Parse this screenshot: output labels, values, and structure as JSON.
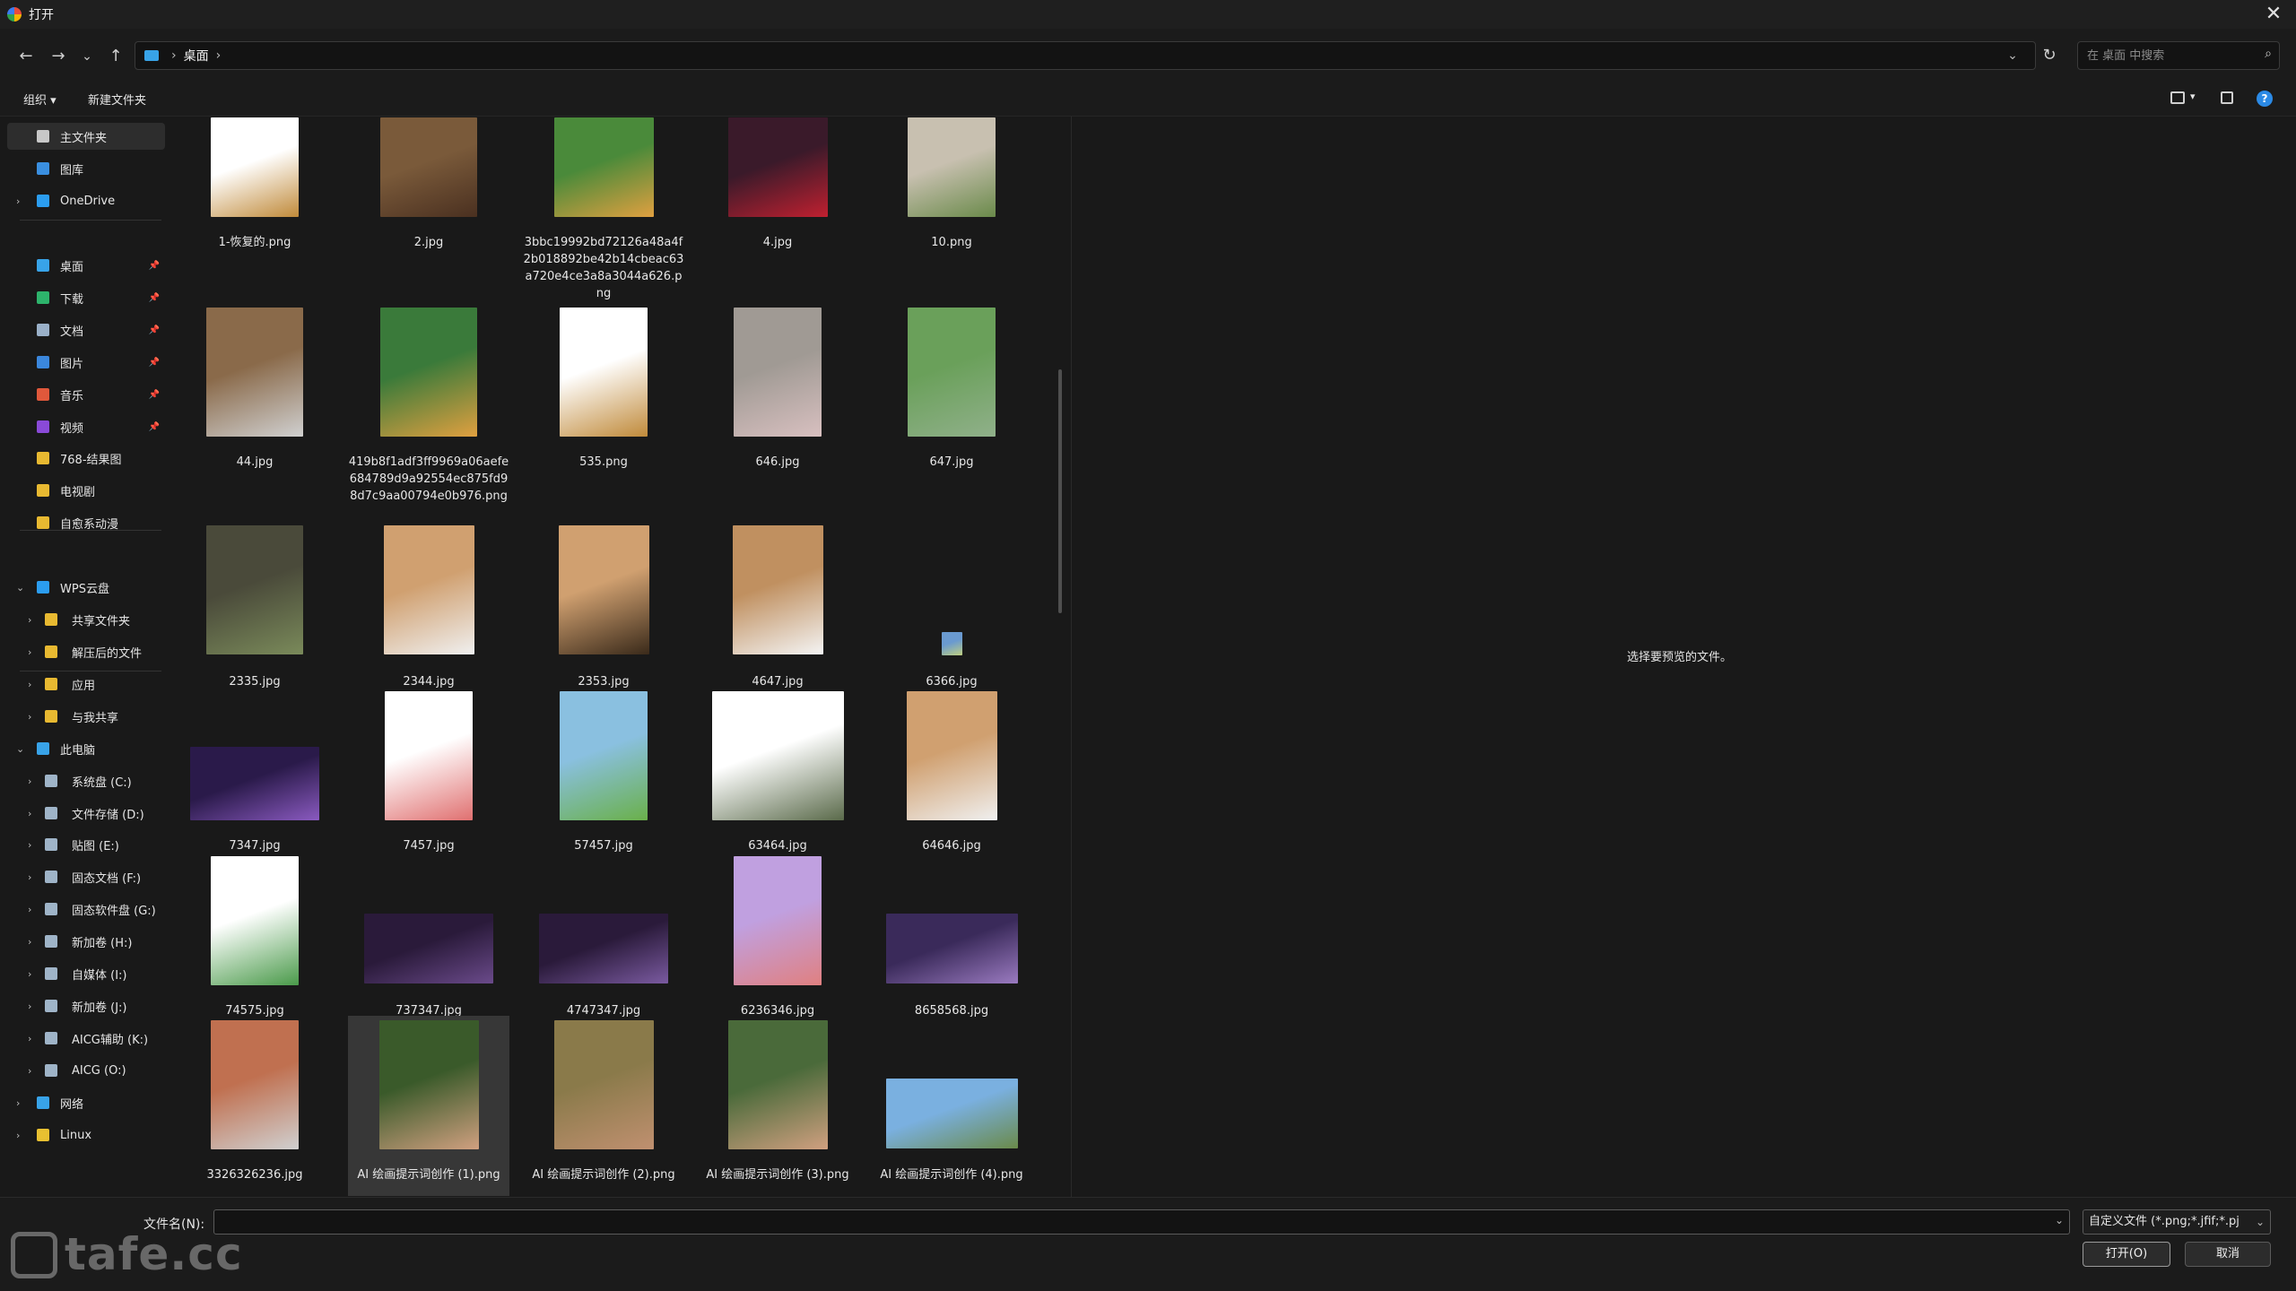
{
  "window": {
    "title": "打开",
    "close": "✕"
  },
  "nav": {
    "back": "←",
    "forward": "→",
    "recent": "⌄",
    "up": "↑",
    "sep": "›",
    "path": "桌面",
    "path_sep_end": "›",
    "addr_dropdown": "⌄",
    "refresh": "↻",
    "search_placeholder": "在 桌面 中搜索",
    "search_icon": "⌕"
  },
  "toolbar": {
    "organize": "组织 ▾",
    "new_folder": "新建文件夹",
    "view_dd": "▾",
    "help": "?"
  },
  "sidebar": {
    "items": [
      {
        "label": "主文件夹",
        "icon": "home-icon",
        "color": "#c8c8c8"
      },
      {
        "label": "图库",
        "icon": "gallery-icon",
        "color": "#3a8fe0"
      },
      {
        "label": "OneDrive",
        "icon": "cloud-icon",
        "color": "#2b9df0"
      },
      {
        "label": "桌面",
        "icon": "desktop-icon",
        "color": "#38a3e8"
      },
      {
        "label": "下载",
        "icon": "download-icon",
        "color": "#2db36b"
      },
      {
        "label": "文档",
        "icon": "document-icon",
        "color": "#9ab0c8"
      },
      {
        "label": "图片",
        "icon": "picture-icon",
        "color": "#3b87dc"
      },
      {
        "label": "音乐",
        "icon": "music-icon",
        "color": "#e0583b"
      },
      {
        "label": "视频",
        "icon": "video-icon",
        "color": "#8a4ad8"
      },
      {
        "label": "768-结果图",
        "icon": "folder-icon",
        "color": "#e8b931"
      },
      {
        "label": "电视剧",
        "icon": "folder-icon",
        "color": "#e8b931"
      },
      {
        "label": "自愈系动漫",
        "icon": "folder-icon",
        "color": "#e8b931"
      },
      {
        "label": "WPS云盘",
        "icon": "cloud-icon",
        "color": "#2b9df0"
      },
      {
        "label": "共享文件夹",
        "icon": "folder-icon",
        "color": "#e8b931"
      },
      {
        "label": "解压后的文件",
        "icon": "folder-icon",
        "color": "#e8b931"
      },
      {
        "label": "应用",
        "icon": "folder-icon",
        "color": "#e8b931"
      },
      {
        "label": "与我共享",
        "icon": "folder-icon",
        "color": "#e8b931"
      },
      {
        "label": "此电脑",
        "icon": "computer-icon",
        "color": "#38a3e8"
      },
      {
        "label": "系统盘 (C:)",
        "icon": "drive-icon",
        "color": "#9fb4c8"
      },
      {
        "label": "文件存储 (D:)",
        "icon": "drive-icon",
        "color": "#9fb4c8"
      },
      {
        "label": "贴图 (E:)",
        "icon": "drive-icon",
        "color": "#9fb4c8"
      },
      {
        "label": "固态文档 (F:)",
        "icon": "drive-icon",
        "color": "#9fb4c8"
      },
      {
        "label": "固态软件盘 (G:)",
        "icon": "drive-icon",
        "color": "#9fb4c8"
      },
      {
        "label": "新加卷 (H:)",
        "icon": "drive-icon",
        "color": "#9fb4c8"
      },
      {
        "label": "自媒体 (I:)",
        "icon": "drive-icon",
        "color": "#9fb4c8"
      },
      {
        "label": "新加卷 (J:)",
        "icon": "drive-icon",
        "color": "#9fb4c8"
      },
      {
        "label": "AICG辅助 (K:)",
        "icon": "drive-icon",
        "color": "#9fb4c8"
      },
      {
        "label": "AICG (O:)",
        "icon": "drive-icon",
        "color": "#9fb4c8"
      },
      {
        "label": "网络",
        "icon": "network-icon",
        "color": "#38a3e8"
      },
      {
        "label": "Linux",
        "icon": "linux-icon",
        "color": "#e8c031"
      }
    ]
  },
  "files": [
    {
      "name": "1-恢复的.png",
      "colors": [
        "#ffffff",
        "#c08a3a"
      ]
    },
    {
      "name": "2.jpg",
      "colors": [
        "#7a5a3a",
        "#4a3020"
      ]
    },
    {
      "name": "3bbc19992bd72126a48a4f2b018892be42b14cbeac63a720e4ce3a8a3044a626.png",
      "colors": [
        "#4a8a3a",
        "#e0a040"
      ]
    },
    {
      "name": "4.jpg",
      "colors": [
        "#3a1a2a",
        "#c02030"
      ]
    },
    {
      "name": "10.png",
      "colors": [
        "#c8c0b0",
        "#6a8a4a"
      ]
    },
    {
      "name": "44.jpg",
      "colors": [
        "#8a6a4a",
        "#d0d0d0"
      ]
    },
    {
      "name": "419b8f1adf3ff9969a06aefe684789d9a92554ec875fd98d7c9aa00794e0b976.png",
      "colors": [
        "#3a7a3a",
        "#e0a040"
      ]
    },
    {
      "name": "535.png",
      "colors": [
        "#ffffff",
        "#c08a3a"
      ]
    },
    {
      "name": "646.jpg",
      "colors": [
        "#a09a94",
        "#d8c0c0"
      ]
    },
    {
      "name": "647.jpg",
      "colors": [
        "#6aa05a",
        "#90b08a"
      ]
    },
    {
      "name": "2335.jpg",
      "colors": [
        "#4a4a3a",
        "#7a8a5a"
      ]
    },
    {
      "name": "2344.jpg",
      "colors": [
        "#d0a070",
        "#f0f0f0"
      ]
    },
    {
      "name": "2353.jpg",
      "colors": [
        "#d0a070",
        "#3a2a1a"
      ]
    },
    {
      "name": "4647.jpg",
      "colors": [
        "#c09060",
        "#f4f4f4"
      ]
    },
    {
      "name": "6366.jpg",
      "colors": [
        "#6a9ad0",
        "#c0d080"
      ]
    },
    {
      "name": "7347.jpg",
      "colors": [
        "#2a1a4a",
        "#8a5ac0"
      ]
    },
    {
      "name": "7457.jpg",
      "colors": [
        "#ffffff",
        "#e07070"
      ]
    },
    {
      "name": "57457.jpg",
      "colors": [
        "#8ac0e0",
        "#6ab04a"
      ]
    },
    {
      "name": "63464.jpg",
      "colors": [
        "#ffffff",
        "#5a6a4a"
      ]
    },
    {
      "name": "64646.jpg",
      "colors": [
        "#d0a070",
        "#f0f0f0"
      ]
    },
    {
      "name": "74575.jpg",
      "colors": [
        "#ffffff",
        "#4a9a4a"
      ]
    },
    {
      "name": "737347.jpg",
      "colors": [
        "#2a1a3a",
        "#6a4a8a"
      ]
    },
    {
      "name": "4747347.jpg",
      "colors": [
        "#2a1a3a",
        "#7a5aa0"
      ]
    },
    {
      "name": "6236346.jpg",
      "colors": [
        "#c0a0e0",
        "#e08080"
      ]
    },
    {
      "name": "8658568.jpg",
      "colors": [
        "#3a2a5a",
        "#9a7ac0"
      ]
    },
    {
      "name": "3326326236.jpg",
      "colors": [
        "#c07050",
        "#d0d0d0"
      ]
    },
    {
      "name": "AI 绘画提示词创作 (1).png",
      "colors": [
        "#3a5a2a",
        "#d0a080"
      ]
    },
    {
      "name": "AI 绘画提示词创作 (2).png",
      "colors": [
        "#8a7a4a",
        "#c09070"
      ]
    },
    {
      "name": "AI 绘画提示词创作 (3).png",
      "colors": [
        "#4a6a3a",
        "#d0a080"
      ]
    },
    {
      "name": "AI 绘画提示词创作 (4).png",
      "colors": [
        "#7ab0e0",
        "#6a8a4a"
      ]
    }
  ],
  "preview": {
    "text": "选择要预览的文件。"
  },
  "footer": {
    "filename_label": "文件名(N):",
    "filename_value": "",
    "filter": "自定义文件 (*.png;*.jfif;*.pj",
    "dd": "⌄",
    "open": "打开(O)",
    "cancel": "取消"
  },
  "watermark": "tafe.cc"
}
